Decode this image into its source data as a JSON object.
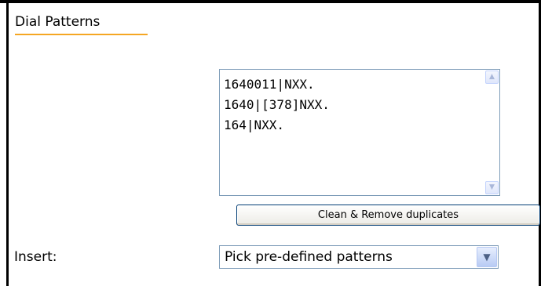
{
  "section": {
    "title": "Dial Patterns"
  },
  "patterns": {
    "lines": [
      "1640011|NXX.",
      "1640|[378]NXX.",
      "164|NXX."
    ]
  },
  "actions": {
    "clean_label": "Clean & Remove duplicates"
  },
  "insert": {
    "label": "Insert:",
    "selected": "Pick pre-defined patterns"
  },
  "icons": {
    "scroll_up": "scroll-up-arrow",
    "scroll_down": "scroll-down-arrow",
    "dropdown": "chevron-down"
  },
  "colors": {
    "title_underline": "#f5a623",
    "input_border": "#7f9db9",
    "button_border": "#003c74"
  }
}
